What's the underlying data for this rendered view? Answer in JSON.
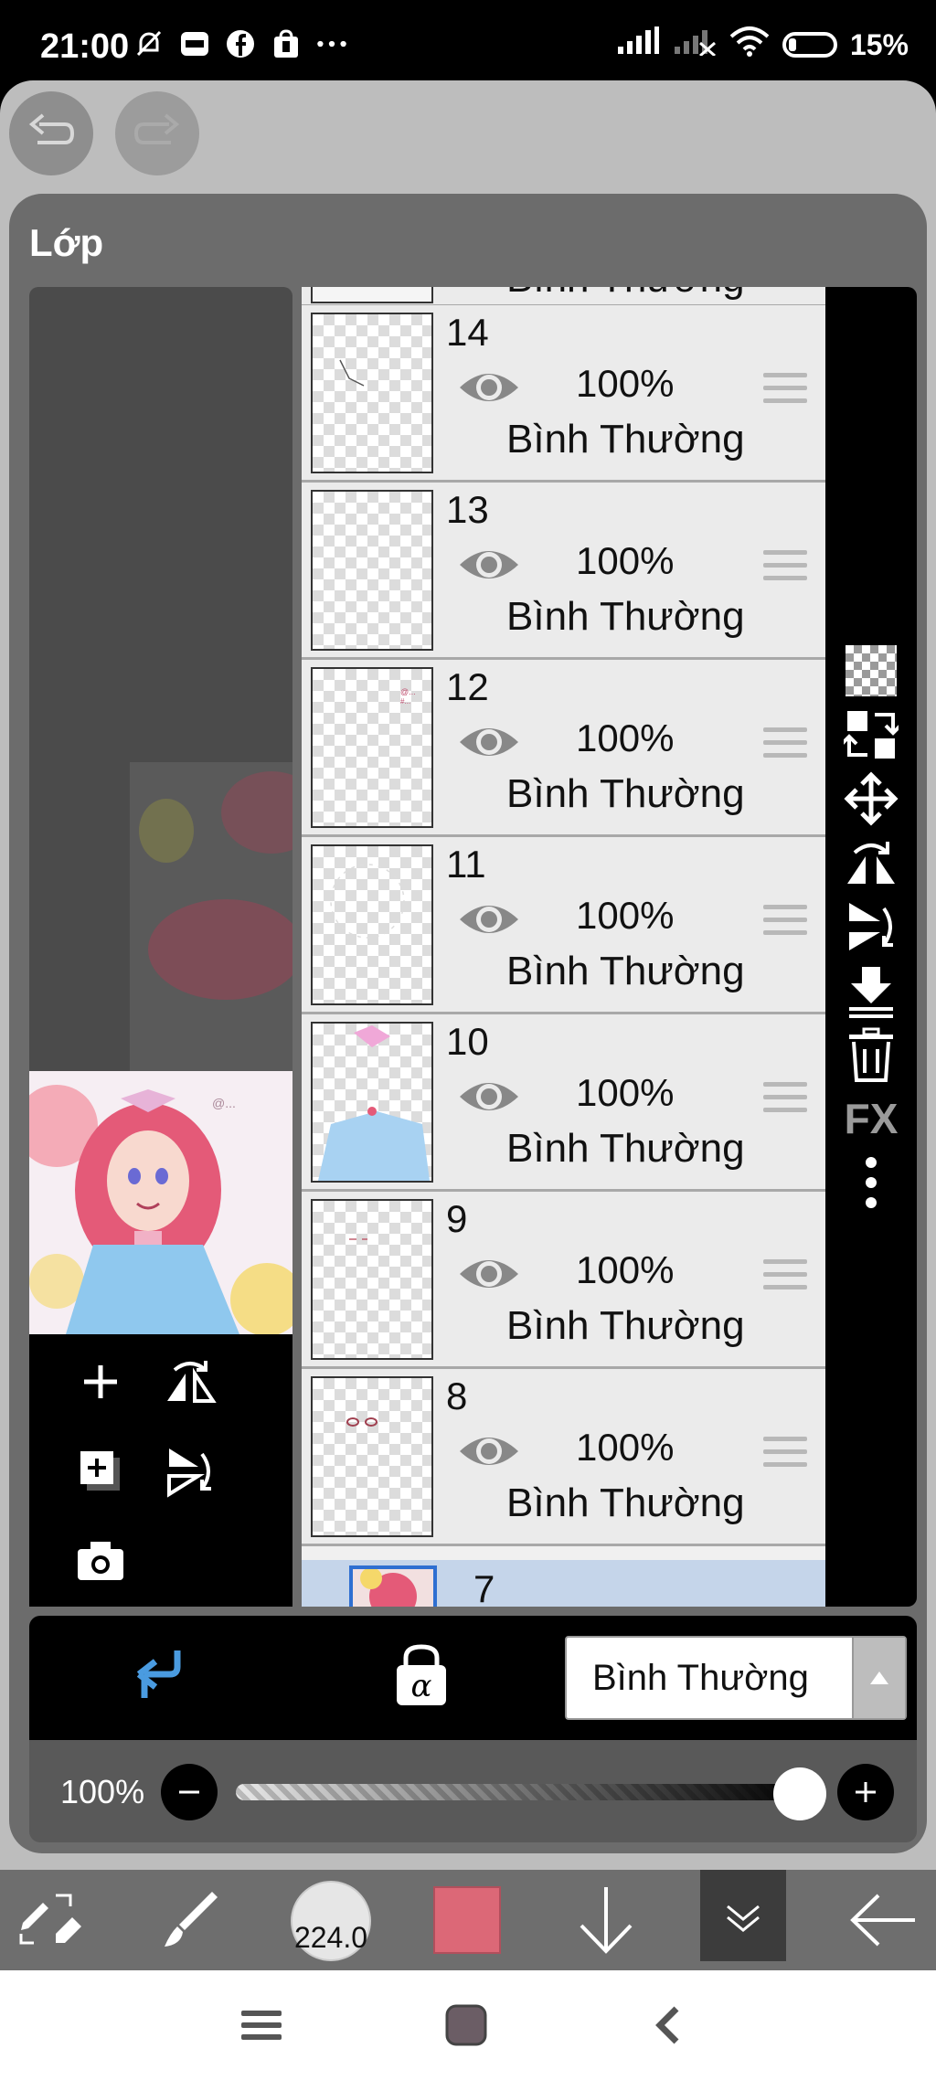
{
  "status_bar": {
    "time": "21:00",
    "battery": "15%",
    "notif_icons": [
      "muted-bell-icon",
      "zalo-icon",
      "facebook-icon",
      "shopee-icon",
      "more-icon"
    ]
  },
  "panel": {
    "title": "Lớp"
  },
  "layers": [
    {
      "number": "14",
      "opacity": "100%",
      "mode": "Bình Thường"
    },
    {
      "number": "13",
      "opacity": "100%",
      "mode": "Bình Thường"
    },
    {
      "number": "12",
      "opacity": "100%",
      "mode": "Bình Thường"
    },
    {
      "number": "11",
      "opacity": "100%",
      "mode": "Bình Thường"
    },
    {
      "number": "10",
      "opacity": "100%",
      "mode": "Bình Thường"
    },
    {
      "number": "9",
      "opacity": "100%",
      "mode": "Bình Thường"
    },
    {
      "number": "8",
      "opacity": "100%",
      "mode": "Bình Thường"
    }
  ],
  "partial_top_layer": {
    "mode": "Bình Thường"
  },
  "selected_layer": {
    "number": "7"
  },
  "blend": {
    "selected": "Bình Thường"
  },
  "opacity": {
    "label": "100%",
    "value_fraction": 1.0
  },
  "brush": {
    "size": "224.0"
  },
  "colors": {
    "current": "#dc6877",
    "accent_blue": "#4a9be0"
  },
  "right_tools": {
    "fx_label": "FX"
  }
}
